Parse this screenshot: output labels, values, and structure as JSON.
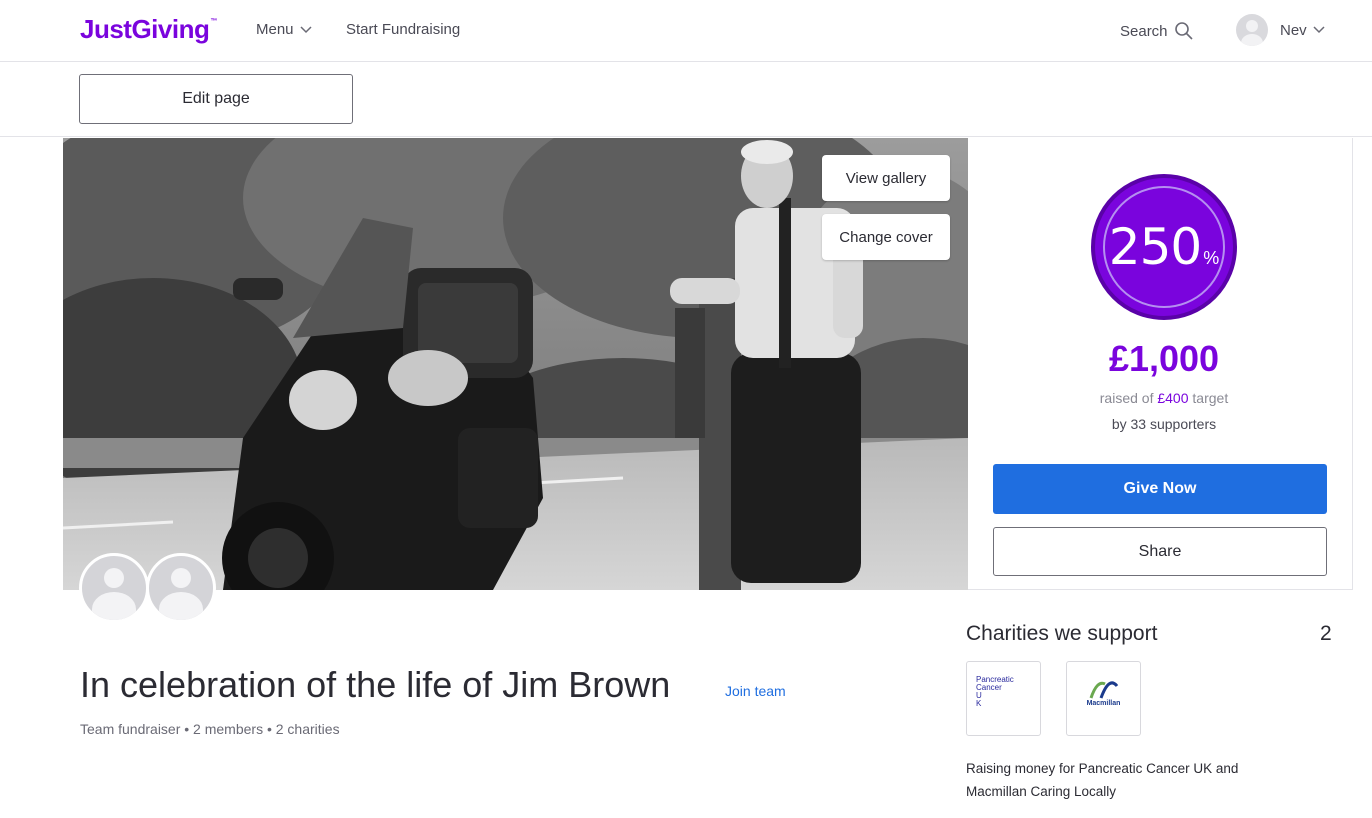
{
  "nav": {
    "logo": "JustGiving",
    "logo_mark": "™",
    "menu": "Menu",
    "start": "Start Fundraising",
    "search": "Search",
    "user": "Nev"
  },
  "edit": {
    "label": "Edit page"
  },
  "hero": {
    "view_gallery": "View gallery",
    "change_cover": "Change cover"
  },
  "stats": {
    "percent": "250",
    "percent_sign": "%",
    "raised": "£1,000",
    "target_prefix": "raised of ",
    "target_amount": "£400",
    "target_suffix": " target",
    "supporters": "by 33 supporters",
    "progress_fraction": 2.5
  },
  "actions": {
    "give": "Give Now",
    "share": "Share"
  },
  "page": {
    "title": "In celebration of the life of Jim Brown",
    "join": "Join team",
    "subline": "Team fundraiser • 2 members • 2 charities"
  },
  "charities": {
    "heading": "Charities we support",
    "count": "2",
    "logo1_text": [
      "Pancreatic",
      "Cancer",
      "U",
      "K"
    ],
    "logo2_text": "Macmillan",
    "desc_prefix": "Raising money for ",
    "charity1": "Pancreatic Cancer UK",
    "desc_and": " and",
    "charity2": "Macmillan Caring Locally"
  },
  "colors": {
    "brand": "#7a04dd",
    "give_button": "#1f6ee0",
    "link": "#1f6ee0"
  }
}
